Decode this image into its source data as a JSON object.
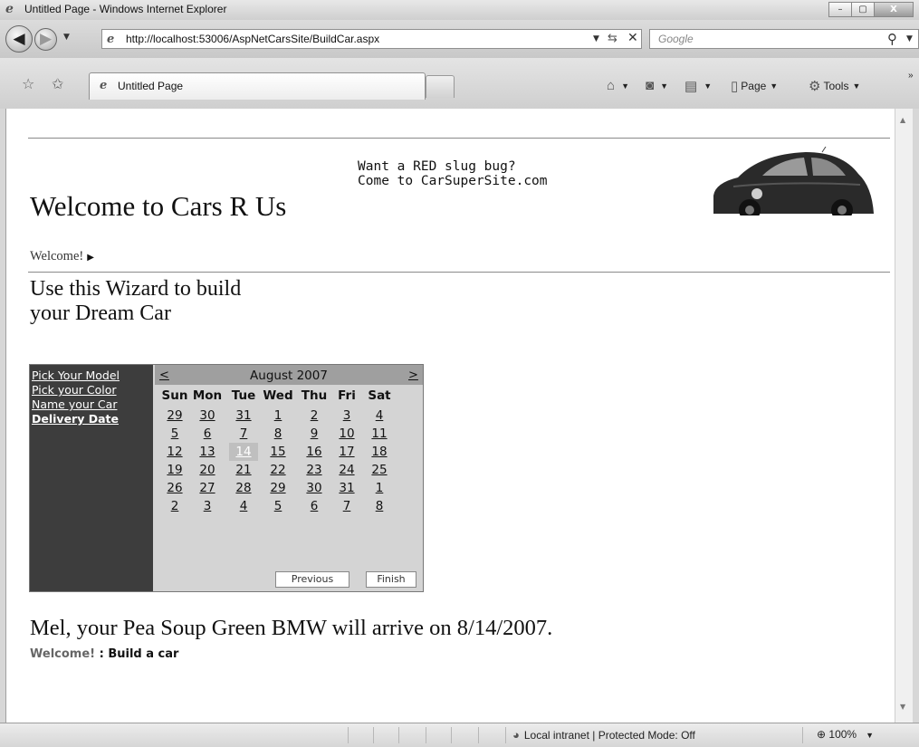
{
  "window": {
    "title": "Untitled Page - Windows Internet Explorer",
    "minimize": "–",
    "maximize": "▢",
    "close": "X"
  },
  "address_bar": {
    "url": "http://localhost:53006/AspNetCarsSite/BuildCar.aspx",
    "search_placeholder": "Google"
  },
  "tab": {
    "label": "Untitled Page"
  },
  "command_bar": {
    "page_label": "Page",
    "tools_label": "Tools"
  },
  "header": {
    "site_title": "Welcome to Cars R Us",
    "ad_line1": "Want a RED slug bug?",
    "ad_line2": "Come to CarSuperSite.com",
    "menu_item": "Welcome!"
  },
  "wizard": {
    "heading_line1": "Use this Wizard to build",
    "heading_line2": "your Dream Car",
    "steps": [
      {
        "label": "Pick Your Model",
        "current": false
      },
      {
        "label": "Pick your Color",
        "current": false
      },
      {
        "label": "Name your Car",
        "current": false
      },
      {
        "label": "Delivery Date",
        "current": true
      }
    ],
    "previous_button": "Previous",
    "finish_button": "Finish"
  },
  "calendar": {
    "month": "August 2007",
    "prev": "<",
    "next": ">",
    "weekdays": [
      "Sun",
      "Mon",
      "Tue",
      "Wed",
      "Thu",
      "Fri",
      "Sat"
    ],
    "weeks": [
      [
        "29",
        "30",
        "31",
        "1",
        "2",
        "3",
        "4"
      ],
      [
        "5",
        "6",
        "7",
        "8",
        "9",
        "10",
        "11"
      ],
      [
        "12",
        "13",
        "14",
        "15",
        "16",
        "17",
        "18"
      ],
      [
        "19",
        "20",
        "21",
        "22",
        "23",
        "24",
        "25"
      ],
      [
        "26",
        "27",
        "28",
        "29",
        "30",
        "31",
        "1"
      ],
      [
        "2",
        "3",
        "4",
        "5",
        "6",
        "7",
        "8"
      ]
    ],
    "selected": "14"
  },
  "result": {
    "message": "Mel, your Pea Soup Green BMW will arrive on 8/14/2007.",
    "breadcrumb_root": "Welcome!",
    "breadcrumb_sep": " : ",
    "breadcrumb_current": "Build a car"
  },
  "status_bar": {
    "zone": "Local intranet | Protected Mode: Off",
    "zoom": "100%"
  },
  "icons": {
    "back": "back-arrow-icon",
    "forward": "forward-arrow-icon",
    "refresh": "refresh-icon",
    "stop": "stop-icon",
    "search": "search-icon",
    "favorites": "favorites-star-icon",
    "home": "home-icon",
    "feeds": "feeds-icon",
    "print": "print-icon",
    "tools": "gear-icon",
    "globe": "intranet-globe-icon",
    "zoom": "zoom-magnifier-icon"
  }
}
